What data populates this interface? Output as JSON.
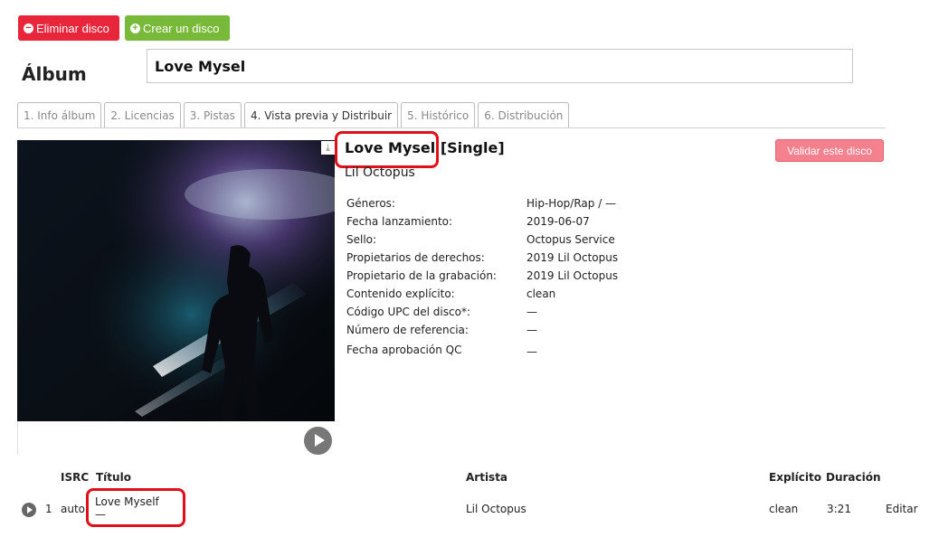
{
  "toolbar": {
    "delete_icon": "minus-circle-icon",
    "delete_label": "Eliminar disco",
    "create_icon": "plus-circle-icon",
    "create_label": "Crear un disco",
    "delete_color": "#e8253b",
    "create_color": "#79b93a"
  },
  "album": {
    "label": "Álbum",
    "title_value": "Love Mysel"
  },
  "tabs": [
    {
      "label": "1. Info álbum",
      "active": false
    },
    {
      "label": "2. Licencias",
      "active": false
    },
    {
      "label": "3. Pistas",
      "active": false
    },
    {
      "label": "4. Vista previa y Distribuir",
      "active": true
    },
    {
      "label": "5. Histórico",
      "active": false
    },
    {
      "label": "6. Distribución",
      "active": false
    }
  ],
  "preview": {
    "download_icon": "download-icon",
    "play_icon": "play-icon",
    "release_title": "Love Mysel [Single]",
    "artist": "Lil Octopus",
    "validate_label": "Validar este disco",
    "highlight_color": "#e0101a",
    "metadata": [
      {
        "key": "Géneros:",
        "value": "Hip-Hop/Rap / —"
      },
      {
        "key": "Fecha lanzamiento:",
        "value": "2019-06-07"
      },
      {
        "key": "Sello:",
        "value": "Octopus Service"
      },
      {
        "key": "Propietarios de derechos:",
        "value": "2019 Lil Octopus"
      },
      {
        "key": "Propietario de la grabación:",
        "value": "2019 Lil Octopus"
      },
      {
        "key": "Contenido explícito:",
        "value": "clean"
      },
      {
        "key": "Código UPC del disco*:",
        "value": "—"
      },
      {
        "key": "Número de referencia:",
        "value": "—"
      },
      {
        "key": "Fecha aprobación QC",
        "value": "—"
      }
    ]
  },
  "tracks": {
    "headers": {
      "isrc": "ISRC",
      "title": "Título",
      "artist": "Artista",
      "explicit": "Explícito",
      "duration": "Duración"
    },
    "rows": [
      {
        "number": "1",
        "isrc": "auto",
        "title": "Love Myself",
        "subtitle": "—",
        "artist": "Lil Octopus",
        "explicit": "clean",
        "duration": "3:21",
        "action": "Editar"
      }
    ]
  }
}
